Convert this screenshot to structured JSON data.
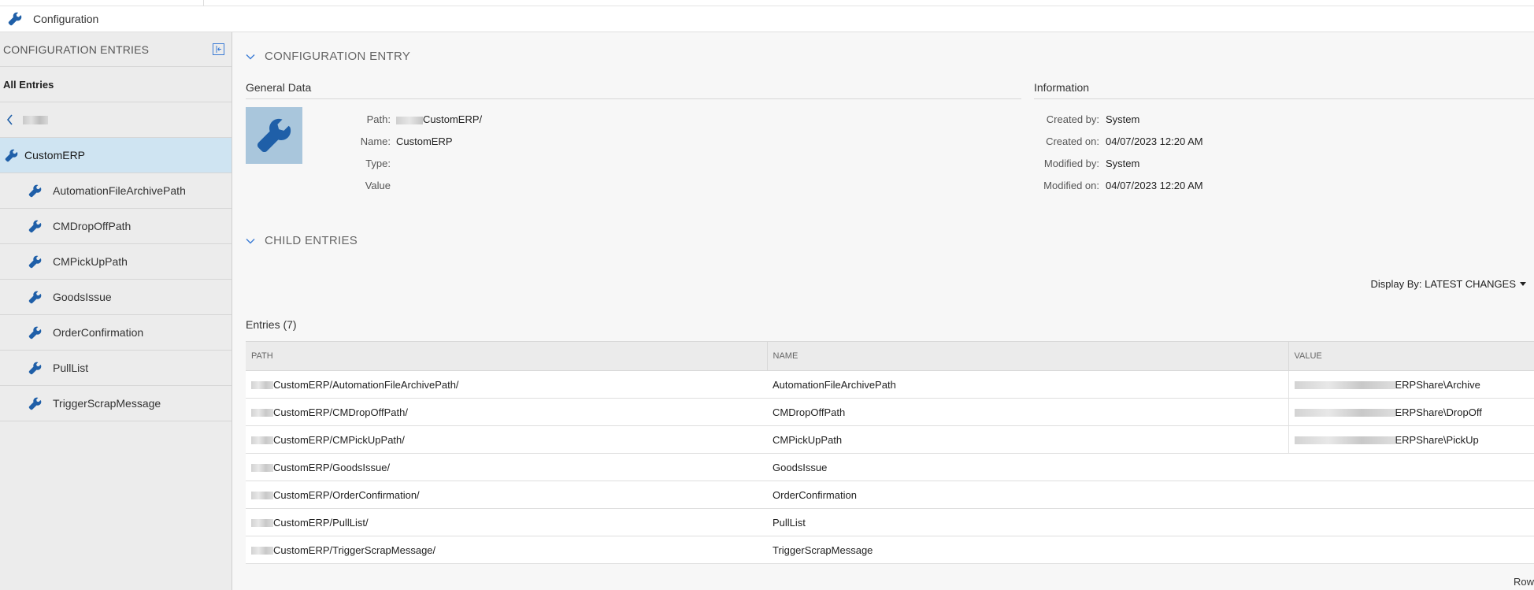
{
  "titlebar": {
    "title": "Configuration",
    "icon": "wrench-icon"
  },
  "sidebar": {
    "header": "CONFIGURATION ENTRIES",
    "all_entries": "All Entries",
    "selected": "CustomERP",
    "children": [
      "AutomationFileArchivePath",
      "CMDropOffPath",
      "CMPickUpPath",
      "GoodsIssue",
      "OrderConfirmation",
      "PullList",
      "TriggerScrapMessage"
    ]
  },
  "config_entry": {
    "section_title": "CONFIGURATION ENTRY",
    "general_data_title": "General Data",
    "information_title": "Information",
    "path_label": "Path:",
    "path_value": "CustomERP/",
    "name_label": "Name:",
    "name_value": "CustomERP",
    "type_label": "Type:",
    "value_label": "Value",
    "created_by_label": "Created by:",
    "created_by_value": "System",
    "created_on_label": "Created on:",
    "created_on_value": "04/07/2023 12:20 AM",
    "modified_by_label": "Modified by:",
    "modified_by_value": "System",
    "modified_on_label": "Modified on:",
    "modified_on_value": "04/07/2023 12:20 AM"
  },
  "child_entries": {
    "section_title": "CHILD ENTRIES",
    "display_by_label": "Display By:",
    "display_by_value": "LATEST CHANGES",
    "entries_title": "Entries (7)",
    "columns": [
      "PATH",
      "NAME",
      "VALUE"
    ],
    "rows": [
      {
        "path": "CustomERP/AutomationFileArchivePath/",
        "name": "AutomationFileArchivePath",
        "value": "ERPShare\\Archive"
      },
      {
        "path": "CustomERP/CMDropOffPath/",
        "name": "CMDropOffPath",
        "value": "ERPShare\\DropOff"
      },
      {
        "path": "CustomERP/CMPickUpPath/",
        "name": "CMPickUpPath",
        "value": "ERPShare\\PickUp"
      },
      {
        "path": "CustomERP/GoodsIssue/",
        "name": "GoodsIssue",
        "value": ""
      },
      {
        "path": "CustomERP/OrderConfirmation/",
        "name": "OrderConfirmation",
        "value": ""
      },
      {
        "path": "CustomERP/PullList/",
        "name": "PullList",
        "value": ""
      },
      {
        "path": "CustomERP/TriggerScrapMessage/",
        "name": "TriggerScrapMessage",
        "value": ""
      }
    ],
    "footer_rows_label": "Row"
  },
  "colors": {
    "accent": "#1f5fa8",
    "selected_bg": "#cfe4f2",
    "tile_bg": "#a9c6dc"
  }
}
